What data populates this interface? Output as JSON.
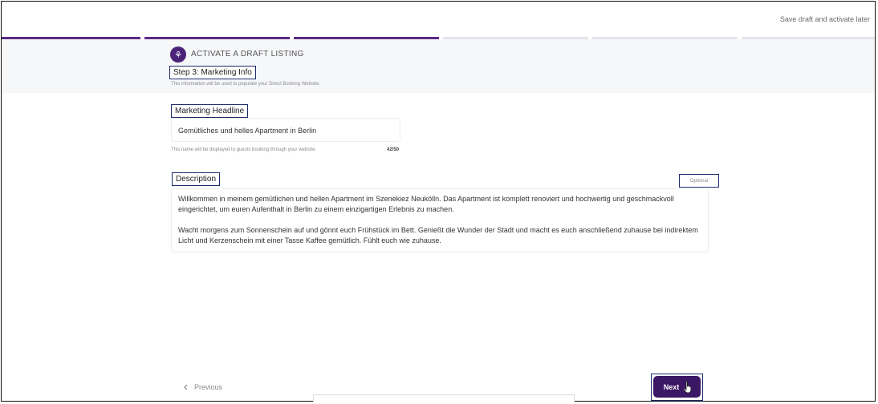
{
  "header": {
    "save_draft_label": "Save draft and activate later"
  },
  "progress": {
    "total_steps": 6,
    "completed_steps": 3
  },
  "page": {
    "logo_glyph": "⚘",
    "title": "ACTIVATE A DRAFT LISTING",
    "step_label": "Step 3:  Marketing Info",
    "step_description": "This information will be used to populate your Direct Booking Website."
  },
  "headline": {
    "label": "Marketing Headline",
    "value": "Gemütliches und helles Apartment in Berlin",
    "hint": "This name will be displayed to guests booking through your website.",
    "counter": "42/50"
  },
  "description": {
    "label": "Description",
    "optional_label": "Optional",
    "paragraphs": [
      "Willkommen in meinem gemütlichen und hellen Apartment im Szenekiez Neukölln. Das Apartment ist komplett renoviert und hochwertig und geschmackvoll eingerichtet, um euren Aufenthalt in Berlin zu einem einzigartigen Erlebnis zu machen.",
      "Wacht morgens zum Sonnenschein auf und gönnt euch Frühstück im Bett. Genießt die Wunder der Stadt und macht es euch anschließend zuhause bei indirektem Licht und Kerzenschein mit einer Tasse Kaffee gemütlich. Fühlt euch wie zuhause."
    ]
  },
  "footer": {
    "previous_label": "Previous",
    "previous_icon": "chevron-left-icon",
    "next_label": "Next"
  },
  "colors": {
    "accent": "#5b2a86",
    "button": "#3b1765"
  }
}
